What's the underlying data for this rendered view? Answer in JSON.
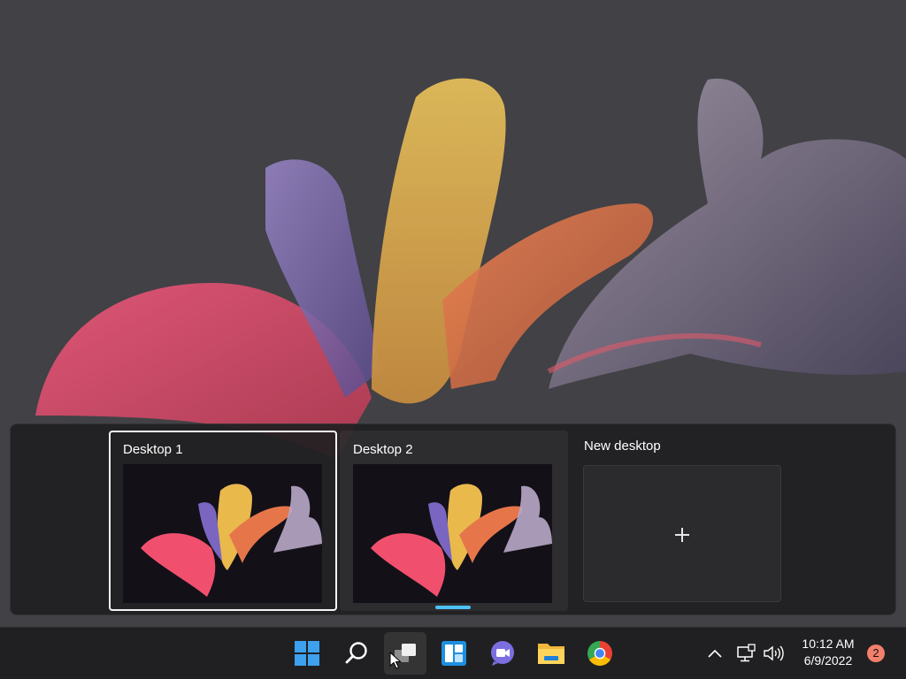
{
  "desktops": [
    {
      "label": "Desktop 1",
      "selected": true
    },
    {
      "label": "Desktop 2",
      "selected": false
    }
  ],
  "new_desktop": {
    "label": "New desktop",
    "icon": "plus-icon"
  },
  "taskbar": {
    "apps": [
      {
        "name": "start",
        "icon": "windows-logo-icon"
      },
      {
        "name": "search",
        "icon": "search-icon"
      },
      {
        "name": "task-view",
        "icon": "task-view-icon",
        "active": true
      },
      {
        "name": "widgets",
        "icon": "widgets-icon"
      },
      {
        "name": "chat",
        "icon": "teams-chat-icon"
      },
      {
        "name": "file-explorer",
        "icon": "folder-icon"
      },
      {
        "name": "chrome",
        "icon": "chrome-icon"
      }
    ],
    "tray": {
      "icons": [
        "chevron-up-icon",
        "network-icon",
        "volume-icon"
      ],
      "time": "10:12 AM",
      "date": "6/9/2022",
      "notification_count": "2"
    }
  },
  "colors": {
    "accent": "#4cc2ff",
    "panel": "#202022",
    "wallpaper_bg": "#414146",
    "badge": "#f3806b"
  }
}
